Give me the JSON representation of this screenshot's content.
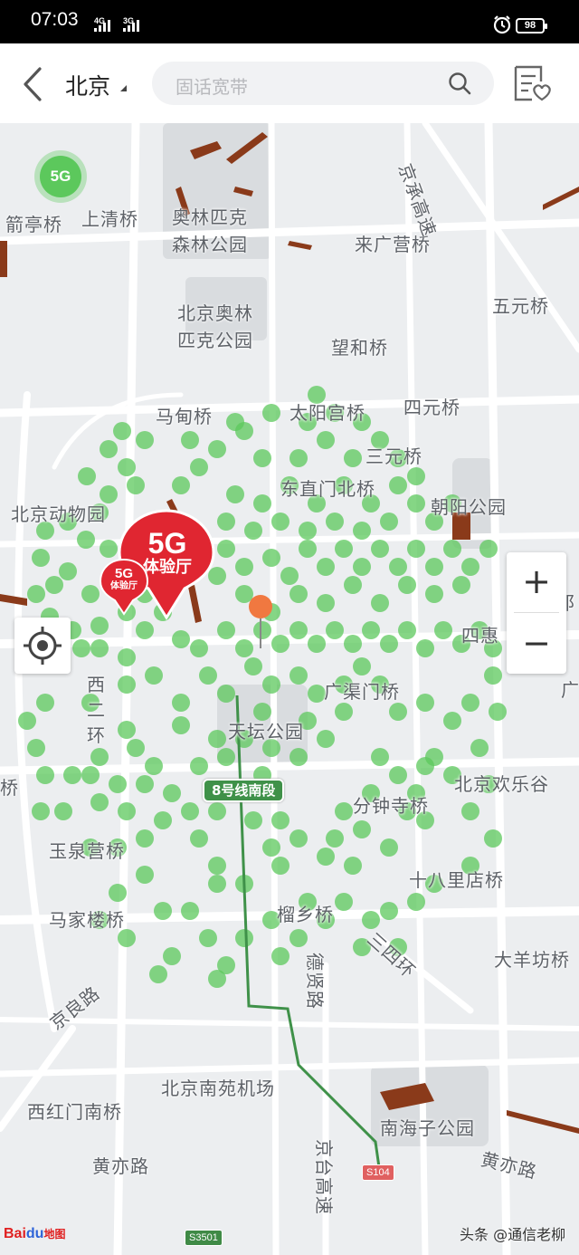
{
  "status_bar": {
    "time": "07:03",
    "signal_1": "4G",
    "signal_2": "3G",
    "battery": "98"
  },
  "header": {
    "city": "北京",
    "search_placeholder": "固话宽带"
  },
  "map": {
    "badge_5g": "5G",
    "labels": {
      "jianting": "箭亭桥",
      "shangqing": "上清桥",
      "olympic_forest_1": "奥林匹克",
      "olympic_forest_2": "森林公园",
      "laiguangying": "来广营桥",
      "jingcheng": "京承高速",
      "wuyuan": "五元桥",
      "olympic_park_1": "北京奥林",
      "olympic_park_2": "匹克公园",
      "wanghe": "望和桥",
      "madian": "马甸桥",
      "taiyanggong": "太阳宫桥",
      "siyuan": "四元桥",
      "sanyuan": "三元桥",
      "dongzhimen": "东直门北桥",
      "zoo": "北京动物园",
      "chaoyang_park": "朝阳公园",
      "sihui": "四惠",
      "guangqumen": "广渠门桥",
      "tiantan": "天坛公园",
      "xi": "西",
      "er": "二",
      "huan": "环",
      "jiao": "桥",
      "happy_valley": "北京欢乐谷",
      "fenzhongsi": "分钟寺桥",
      "yuquanying": "玉泉营桥",
      "shibalidian": "十八里店桥",
      "majialou": "马家楼桥",
      "liuxiang": "榴乡桥",
      "wuhuan": "三四环",
      "dayangfang": "大羊坊桥",
      "jingliang": "京良路",
      "dexian": "德贤路",
      "nanyuan": "北京南苑机场",
      "xihongmen": "西红门南桥",
      "nanhaizi": "南海子公园",
      "huangyi_1": "黄亦路",
      "huangyi_2": "黄亦路",
      "jingtai": "京台高速",
      "edge_r1": "阝",
      "edge_r2": "广"
    },
    "pin_large": {
      "line1": "5G",
      "line2": "体验厅"
    },
    "pin_small": {
      "line1": "5G",
      "line2": "体验厅"
    },
    "subway_badge": "8号线南段",
    "highway_s3501": "S3501",
    "highway_s104": "S104",
    "logo": {
      "bai": "Bai",
      "du": "du",
      "suffix": "地图"
    },
    "watermark": "头条 @通信老柳",
    "zoom_in": "+",
    "zoom_out": "−"
  },
  "colors": {
    "coverage": "#5cc85c",
    "pin": "#e02631",
    "subway": "#3f9149",
    "accent_orange": "#f07840"
  }
}
